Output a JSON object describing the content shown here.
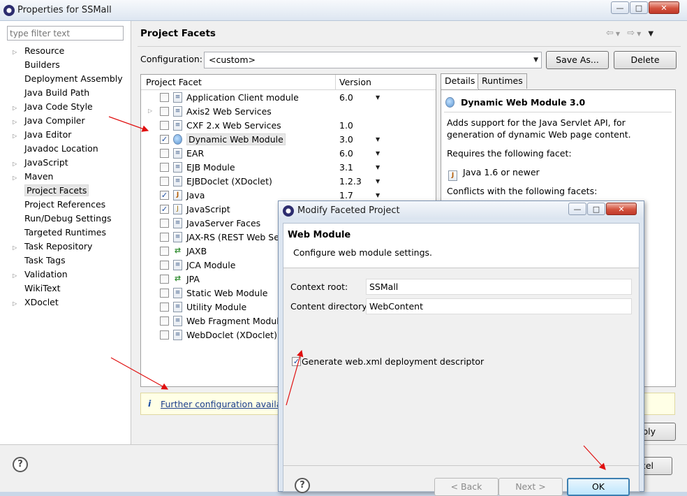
{
  "main_window": {
    "title": "Properties for SSMall",
    "filter_placeholder": "type filter text",
    "nav_items": [
      {
        "label": "Resource",
        "expandable": true
      },
      {
        "label": "Builders",
        "expandable": false
      },
      {
        "label": "Deployment Assembly",
        "expandable": false
      },
      {
        "label": "Java Build Path",
        "expandable": false
      },
      {
        "label": "Java Code Style",
        "expandable": true
      },
      {
        "label": "Java Compiler",
        "expandable": true
      },
      {
        "label": "Java Editor",
        "expandable": true
      },
      {
        "label": "Javadoc Location",
        "expandable": false
      },
      {
        "label": "JavaScript",
        "expandable": true
      },
      {
        "label": "Maven",
        "expandable": true
      },
      {
        "label": "Project Facets",
        "expandable": false,
        "selected": true
      },
      {
        "label": "Project References",
        "expandable": false
      },
      {
        "label": "Run/Debug Settings",
        "expandable": false
      },
      {
        "label": "Targeted Runtimes",
        "expandable": false
      },
      {
        "label": "Task Repository",
        "expandable": true
      },
      {
        "label": "Task Tags",
        "expandable": false
      },
      {
        "label": "Validation",
        "expandable": true
      },
      {
        "label": "WikiText",
        "expandable": false
      },
      {
        "label": "XDoclet",
        "expandable": true
      }
    ],
    "page_title": "Project Facets",
    "configuration_label": "Configuration:",
    "configuration_value": "<custom>",
    "save_as_label": "Save As...",
    "delete_label": "Delete",
    "table_headers": {
      "facet": "Project Facet",
      "version": "Version"
    },
    "facets": [
      {
        "name": "Application Client module",
        "version": "6.0",
        "checked": false,
        "dropdown": true,
        "icon": "doc"
      },
      {
        "name": "Axis2 Web Services",
        "version": "",
        "checked": false,
        "dropdown": false,
        "icon": "doc",
        "expander": true
      },
      {
        "name": "CXF 2.x Web Services",
        "version": "1.0",
        "checked": false,
        "dropdown": false,
        "icon": "doc"
      },
      {
        "name": "Dynamic Web Module",
        "version": "3.0",
        "checked": true,
        "dropdown": true,
        "icon": "globe",
        "highlight": true
      },
      {
        "name": "EAR",
        "version": "6.0",
        "checked": false,
        "dropdown": true,
        "icon": "doc"
      },
      {
        "name": "EJB Module",
        "version": "3.1",
        "checked": false,
        "dropdown": true,
        "icon": "doc"
      },
      {
        "name": "EJBDoclet (XDoclet)",
        "version": "1.2.3",
        "checked": false,
        "dropdown": true,
        "icon": "doc"
      },
      {
        "name": "Java",
        "version": "1.7",
        "checked": true,
        "dropdown": true,
        "icon": "java"
      },
      {
        "name": "JavaScript",
        "version": "",
        "checked": true,
        "dropdown": false,
        "icon": "js"
      },
      {
        "name": "JavaServer Faces",
        "version": "",
        "checked": false,
        "dropdown": false,
        "icon": "doc"
      },
      {
        "name": "JAX-RS (REST Web Ser",
        "version": "",
        "checked": false,
        "dropdown": false,
        "icon": "doc"
      },
      {
        "name": "JAXB",
        "version": "",
        "checked": false,
        "dropdown": false,
        "icon": "arrows"
      },
      {
        "name": "JCA Module",
        "version": "",
        "checked": false,
        "dropdown": false,
        "icon": "doc"
      },
      {
        "name": "JPA",
        "version": "",
        "checked": false,
        "dropdown": false,
        "icon": "arrows"
      },
      {
        "name": "Static Web Module",
        "version": "",
        "checked": false,
        "dropdown": false,
        "icon": "doc"
      },
      {
        "name": "Utility Module",
        "version": "",
        "checked": false,
        "dropdown": false,
        "icon": "doc"
      },
      {
        "name": "Web Fragment Module",
        "version": "",
        "checked": false,
        "dropdown": false,
        "icon": "doc"
      },
      {
        "name": "WebDoclet (XDoclet)",
        "version": "",
        "checked": false,
        "dropdown": false,
        "icon": "doc"
      }
    ],
    "details_tab": "Details",
    "runtimes_tab": "Runtimes",
    "details": {
      "title": "Dynamic Web Module 3.0",
      "description": "Adds support for the Java Servlet API, for generation of dynamic Web page content.",
      "requires_label": "Requires the following facet:",
      "requires_item": "Java 1.6 or newer",
      "conflicts_label": "Conflicts with the following facets:"
    },
    "info_text": "Further configuration availab",
    "apply_fragment": "ply",
    "cancel_fragment": "cel",
    "help_glyph": "?"
  },
  "dialog": {
    "title": "Modify Faceted Project",
    "banner_title": "Web Module",
    "banner_desc": "Configure web module settings.",
    "context_root_label": "Context root:",
    "context_root_value": "SSMall",
    "content_dir_label": "Content directory:",
    "content_dir_value": "WebContent",
    "generate_label": "Generate web.xml deployment descriptor",
    "generate_checked": true,
    "back_label": "< Back",
    "next_label": "Next >",
    "ok_label": "OK",
    "help_glyph": "?"
  },
  "colors": {
    "annotation_arrow": "#e01010",
    "link": "#1b3d8c",
    "ok_border": "#3c7fb1"
  }
}
